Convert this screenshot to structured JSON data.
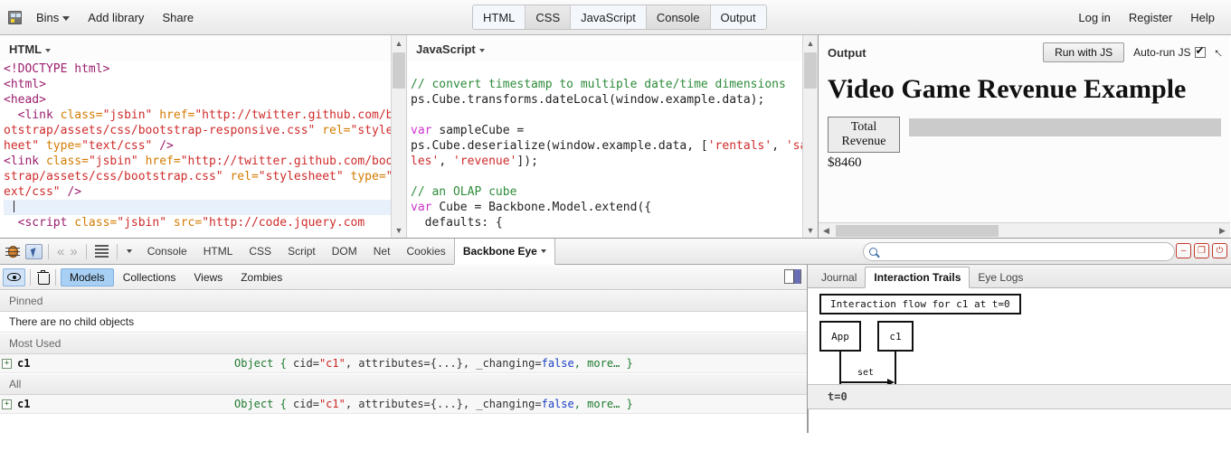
{
  "topbar": {
    "bins_label": "Bins",
    "bins_icon": "bins-icon",
    "add_library": "Add library",
    "share": "Share",
    "panels": [
      {
        "label": "HTML",
        "active": true
      },
      {
        "label": "CSS",
        "active": false
      },
      {
        "label": "JavaScript",
        "active": false
      },
      {
        "label": "Console",
        "active": false
      },
      {
        "label": "Output",
        "active": true
      }
    ],
    "login": "Log in",
    "register": "Register",
    "help": "Help"
  },
  "html_pane": {
    "label": "HTML",
    "code_lines": [
      "<!DOCTYPE html>",
      "<html>",
      "<head>",
      "  <link class=\"jsbin\" href=\"http://twitter.github.com/bootstrap/assets/css/bootstrap-responsive.css\" rel=\"stylesheet\" type=\"text/css\" />",
      "<link class=\"jsbin\" href=\"http://twitter.github.com/bootstrap/assets/css/bootstrap.css\" rel=\"stylesheet\" type=\"text/css\" />",
      "",
      "  <script class=\"jsbin\" src=\"http://code.jquery.com"
    ]
  },
  "js_pane": {
    "label": "JavaScript",
    "code_lines": [
      "// convert timestamp to multiple date/time dimensions",
      "ps.Cube.transforms.dateLocal(window.example.data);",
      "",
      "var sampleCube =",
      "ps.Cube.deserialize(window.example.data, ['rentals', 'sales', 'revenue']);",
      "",
      "// an OLAP cube",
      "var Cube = Backbone.Model.extend({",
      "  defaults: {"
    ]
  },
  "output_pane": {
    "title": "Output",
    "run_button": "Run with JS",
    "autorun_label": "Auto-run JS",
    "autorun_checked": true,
    "expand_icon": "expand-arrow-icon",
    "heading": "Video Game Revenue Example",
    "button_label": "Total Revenue",
    "amount": "$8460"
  },
  "firebug": {
    "bug_icon": "firebug-bug-icon",
    "inspect_icon": "inspect-element-icon",
    "prev_icon": "previous-icon",
    "next_icon": "next-icon",
    "menu_icon": "menu-lines-icon",
    "options_icon": "chevron-down-icon",
    "tabs": [
      {
        "label": "Console",
        "active": false
      },
      {
        "label": "HTML",
        "active": false
      },
      {
        "label": "CSS",
        "active": false
      },
      {
        "label": "Script",
        "active": false
      },
      {
        "label": "DOM",
        "active": false
      },
      {
        "label": "Net",
        "active": false
      },
      {
        "label": "Cookies",
        "active": false
      },
      {
        "label": "Backbone Eye",
        "active": true
      }
    ],
    "search_placeholder": "",
    "search_value": "",
    "search_icon": "search-icon",
    "window_buttons": [
      {
        "name": "minimize-button",
        "glyph": "–"
      },
      {
        "name": "restore-button",
        "glyph": "❐"
      },
      {
        "name": "close-button",
        "glyph": "⏻"
      }
    ]
  },
  "backbone_eye": {
    "eye_icon": "eye-icon",
    "trash_icon": "trash-icon",
    "tabs": [
      {
        "label": "Models",
        "active": true
      },
      {
        "label": "Collections",
        "active": false
      },
      {
        "label": "Views",
        "active": false
      },
      {
        "label": "Zombies",
        "active": false
      }
    ],
    "panel_toggle_icon": "side-panel-toggle-icon",
    "sections": [
      {
        "header": "Pinned",
        "empty_text": "There are no child objects"
      },
      {
        "header": "Most Used"
      },
      {
        "header": "All"
      }
    ],
    "object_row": {
      "expander": "+",
      "name": "c1",
      "desc_prefix": "Object { ",
      "desc_key1": "cid=",
      "desc_val1": "\"c1\"",
      "desc_key2": ", attributes=",
      "desc_val2": "{...}",
      "desc_key3": ", _changing=",
      "desc_val3": "false",
      "desc_suffix": ", more… }"
    }
  },
  "trails": {
    "tabs": [
      {
        "label": "Journal",
        "active": false
      },
      {
        "label": "Interaction Trails",
        "active": true
      },
      {
        "label": "Eye Logs",
        "active": false
      }
    ],
    "diagram": {
      "title": "Interaction flow for c1 at t=0",
      "actors": [
        "App",
        "c1"
      ],
      "message_label": "set",
      "return_style": "dashed"
    },
    "footer_label": "t=0"
  },
  "colors": {
    "accent_blue": "#a8d0f5",
    "firebug_red": "#c0392b",
    "active_tab_bg": "#f4f8fd",
    "code_string": "#cf2b2b",
    "code_comment": "#2e8b3a",
    "code_keyword": "#cc33cc",
    "object_green": "#1f7a2e"
  }
}
